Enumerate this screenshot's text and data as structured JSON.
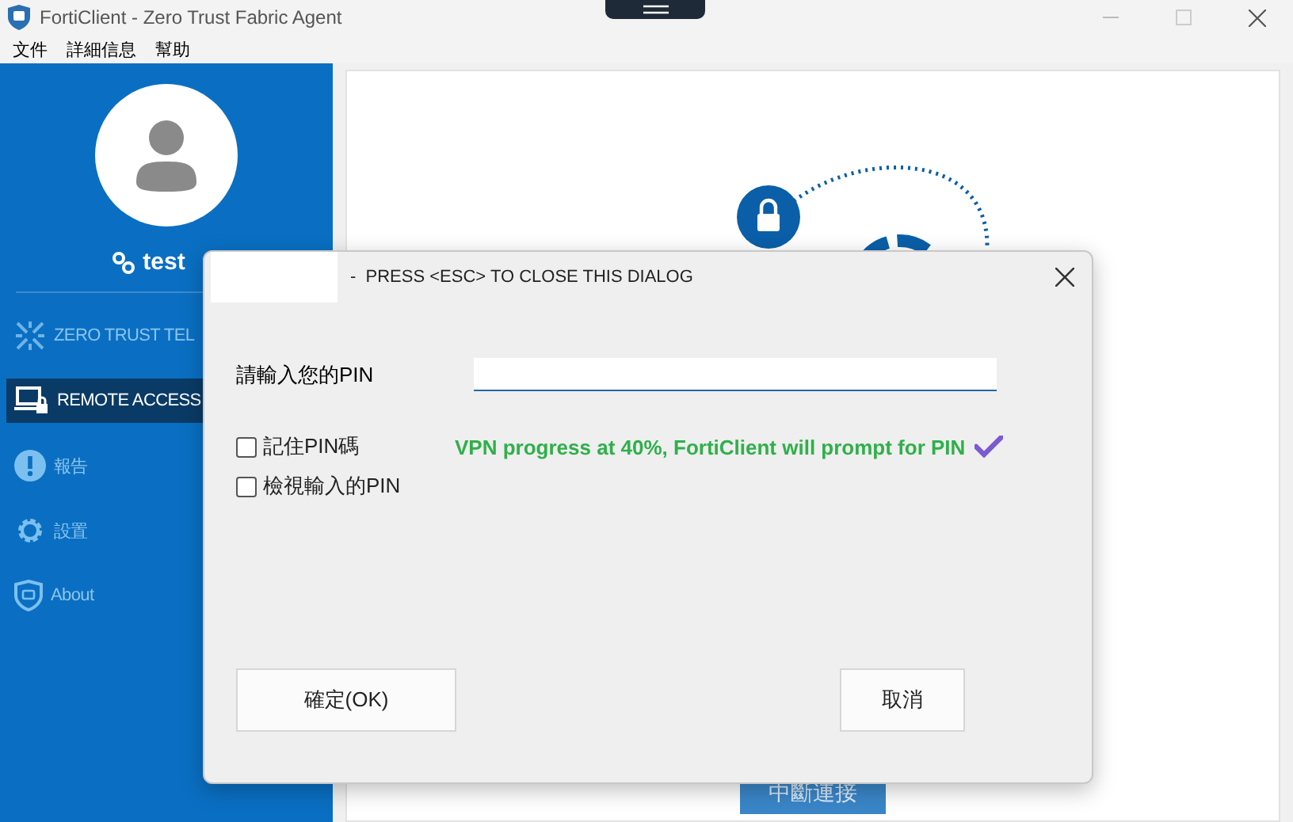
{
  "window": {
    "title": "FortiClient - Zero Trust Fabric Agent"
  },
  "menu": [
    "文件",
    "詳細信息",
    "幫助"
  ],
  "sidebar": {
    "user": "test",
    "items": [
      {
        "kind": "zta",
        "label": "ZERO TRUST TEL",
        "selected": false
      },
      {
        "kind": "remote",
        "label": "REMOTE ACCESS",
        "selected": true
      },
      {
        "kind": "report",
        "label": "報告",
        "selected": false
      },
      {
        "kind": "settings",
        "label": "設置",
        "selected": false
      },
      {
        "kind": "about",
        "label": "About",
        "selected": false
      }
    ]
  },
  "main": {
    "disconnect_button": "中斷連接"
  },
  "dialog": {
    "title": "-  PRESS <ESC> TO CLOSE THIS DIALOG",
    "pin_label": "請輸入您的PIN",
    "checkboxes": [
      {
        "label": "記住PIN碼",
        "checked": false
      },
      {
        "label": "檢視輸入的PIN",
        "checked": false
      }
    ],
    "note": "VPN progress at 40%, FortiClient will prompt for PIN",
    "ok_button": "確定(OK)",
    "cancel_button": "取消"
  }
}
